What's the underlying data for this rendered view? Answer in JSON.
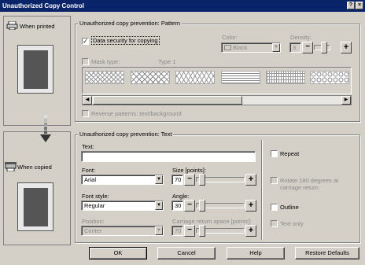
{
  "window": {
    "title": "Unauthorized Copy Control",
    "help": "?",
    "close": "×"
  },
  "left": {
    "when_printed": "When printed",
    "when_copied": "When copied"
  },
  "pattern_group": {
    "title": "Unauthorized copy prevention: Pattern",
    "data_security_label": "Data security for copying",
    "data_security_checked": "✓",
    "color_label": "Color:",
    "color_value": "Black",
    "density_label": "Density:",
    "density_value": "3",
    "mask_type_label": "Mask type:",
    "mask_type_value": "Type 1",
    "reverse_label": "Reverse patterns: text/background"
  },
  "text_group": {
    "title": "Unauthorized copy prevention: Text",
    "text_label": "Text:",
    "text_value": "",
    "font_label": "Font:",
    "font_value": "Arial",
    "size_label": "Size [points]:",
    "size_value": "70",
    "font_style_label": "Font style:",
    "font_style_value": "Regular",
    "angle_label": "Angle:",
    "angle_value": "30",
    "position_label": "Position:",
    "position_value": "Center",
    "carriage_label": "Carriage return space [points]:",
    "carriage_value": "70",
    "repeat_label": "Repeat",
    "rotate_label": "Rotate 180 degrees at carriage return",
    "outline_label": "Outline",
    "text_only_label": "Text only"
  },
  "buttons": {
    "ok": "OK",
    "cancel": "Cancel",
    "help": "Help",
    "restore": "Restore Defaults"
  },
  "glyphs": {
    "minus": "−",
    "plus": "+",
    "down": "▼",
    "left": "◀",
    "right": "▶"
  }
}
